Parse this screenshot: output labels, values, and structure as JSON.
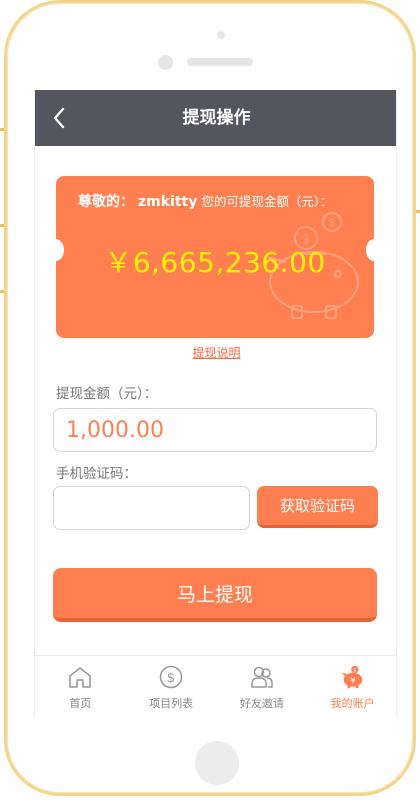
{
  "header": {
    "title": "提现操作"
  },
  "card": {
    "greeting": "尊敬的：",
    "username": "zmkitty",
    "suffix": "您的可提现金额（元）：",
    "amount": "￥6,665,236.00"
  },
  "explain_link": "提现说明",
  "form": {
    "amount_label": "提现金额（元）：",
    "amount_value": "1,000.00",
    "code_label": "手机验证码：",
    "code_value": "",
    "code_button": "获取验证码",
    "submit_button": "马上提现"
  },
  "tabs": [
    {
      "label": "首页",
      "icon": "home-icon",
      "active": false
    },
    {
      "label": "项目列表",
      "icon": "dollar-icon",
      "active": false
    },
    {
      "label": "好友邀请",
      "icon": "friends-icon",
      "active": false
    },
    {
      "label": "我的账户",
      "icon": "piggy-bank-icon",
      "active": true
    }
  ],
  "colors": {
    "accent": "#ff7f50",
    "header_bg": "#555560",
    "amount_text": "#fff200",
    "frame": "#f3d58e"
  }
}
